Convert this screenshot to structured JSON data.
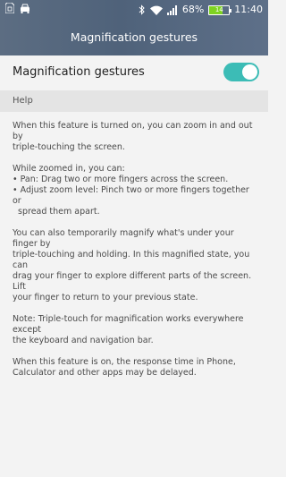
{
  "status_bar": {
    "battery_percent": "68%",
    "battery_inner": "14",
    "battery_level": 0.68,
    "time": "11:40",
    "icons": [
      "sim-icon",
      "car-icon",
      "bluetooth-icon",
      "wifi-icon",
      "signal-icon",
      "battery-icon"
    ]
  },
  "header": {
    "title": "Magnification gestures",
    "background_colors": [
      "#5c6d82",
      "#4f627a",
      "#5e7089"
    ]
  },
  "toggle": {
    "label": "Magnification gestures",
    "state": "on",
    "accent_color": "#3cbcb6"
  },
  "help": {
    "heading": "Help",
    "paragraphs": [
      {
        "lines": [
          "When this feature is turned on, you can zoom in and out by",
          "triple-touching the screen."
        ]
      },
      {
        "lines": [
          "While zoomed in, you can:",
          "• Pan: Drag two or more fingers across the screen.",
          "• Adjust zoom level: Pinch two or more fingers together or",
          "  spread them apart."
        ]
      },
      {
        "lines": [
          "You can also temporarily magnify what's under your finger by",
          "triple-touching and holding. In this magnified state, you can",
          "drag your finger to explore different parts of the screen. Lift",
          "your finger to return to your previous state."
        ]
      },
      {
        "lines": [
          "Note: Triple-touch for magnification works everywhere except",
          "the keyboard and navigation bar."
        ]
      },
      {
        "lines": [
          "When this feature is on, the response time in Phone,",
          "Calculator and other apps may be delayed."
        ]
      }
    ]
  }
}
